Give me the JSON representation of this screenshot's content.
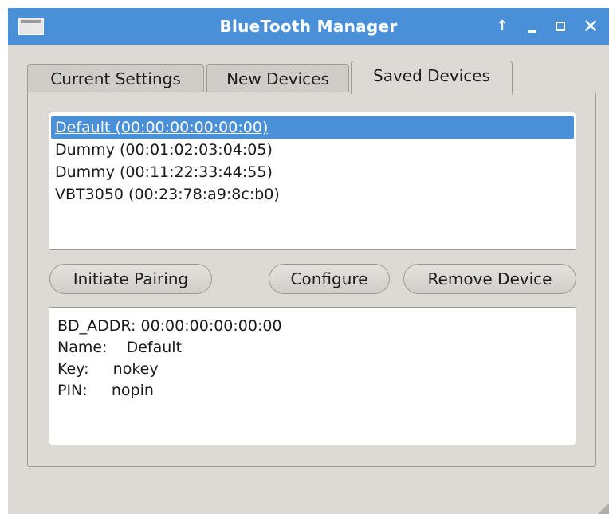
{
  "window": {
    "title": "BlueTooth Manager",
    "controls": {
      "up_glyph": "↑",
      "close_glyph": "✕"
    }
  },
  "tabs": [
    {
      "label": "Current Settings",
      "active": false
    },
    {
      "label": "New Devices",
      "active": false
    },
    {
      "label": "Saved Devices",
      "active": true
    }
  ],
  "device_list": {
    "items": [
      {
        "label": "Default (00:00:00:00:00:00)",
        "selected": true
      },
      {
        "label": "Dummy (00:01:02:03:04:05)",
        "selected": false
      },
      {
        "label": "Dummy (00:11:22:33:44:55)",
        "selected": false
      },
      {
        "label": "VBT3050 (00:23:78:a9:8c:b0)",
        "selected": false
      }
    ]
  },
  "buttons": {
    "initiate_pairing": "Initiate Pairing",
    "configure": "Configure",
    "remove_device": "Remove Device"
  },
  "details": {
    "lines": [
      "BD_ADDR: 00:00:00:00:00:00",
      "Name:    Default",
      "Key:     nokey",
      "PIN:     nopin"
    ]
  },
  "colors": {
    "accent": "#4a90d9",
    "window_bg": "#dcdad5"
  }
}
